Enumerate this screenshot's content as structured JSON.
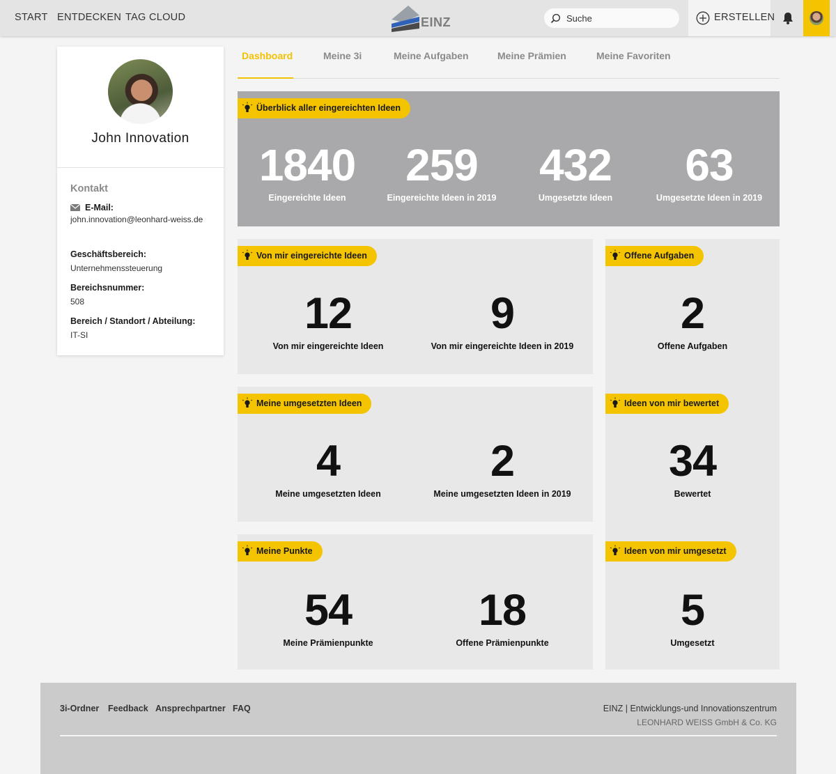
{
  "nav": {
    "start": "START",
    "entdecken": "ENTDECKEN",
    "tag_cloud": "TAG CLOUD",
    "logo_text": "EINZ",
    "search_placeholder": "Suche",
    "create_label": "ERSTELLEN"
  },
  "profile": {
    "name": "John Innovation",
    "contact_title": "Kontakt",
    "email_label": "E-Mail:",
    "email": "john.innovation@leonhard-weiss.de",
    "business_label": "Geschäftsbereich:",
    "business": "Unternehmenssteuerung",
    "area_number_label": "Bereichsnummer:",
    "area_number": "508",
    "department_label": "Bereich / Standort / Abteilung:",
    "department": "IT-SI"
  },
  "tabs": [
    "Dashboard",
    "Meine 3i",
    "Meine Aufgaben",
    "Meine Prämien",
    "Meine Favoriten"
  ],
  "overview": {
    "title": "Überblick aller eingereichten Ideen",
    "stats": [
      {
        "value": "1840",
        "label": "Eingereichte Ideen"
      },
      {
        "value": "259",
        "label": "Eingereichte Ideen in 2019"
      },
      {
        "value": "432",
        "label": "Umgesetzte Ideen"
      },
      {
        "value": "63",
        "label": "Umgesetzte Ideen in 2019"
      }
    ]
  },
  "my_ideas": {
    "title": "Von mir eingereichte Ideen",
    "stats": [
      {
        "value": "12",
        "label": "Von mir eingereichte Ideen"
      },
      {
        "value": "9",
        "label": "Von mir eingereichte Ideen in 2019"
      }
    ]
  },
  "open_tasks": {
    "title": "Offene Aufgaben",
    "stats": [
      {
        "value": "2",
        "label": "Offene Aufgaben"
      }
    ]
  },
  "implemented": {
    "title": "Meine umgesetzten Ideen",
    "stats": [
      {
        "value": "4",
        "label": "Meine umgesetzten Ideen"
      },
      {
        "value": "2",
        "label": "Meine umgesetzten Ideen in 2019"
      }
    ]
  },
  "rated": {
    "title": "Ideen von mir bewertet",
    "stats": [
      {
        "value": "34",
        "label": "Bewertet"
      }
    ]
  },
  "points": {
    "title": "Meine Punkte",
    "stats": [
      {
        "value": "54",
        "label": "Meine Prämienpunkte"
      },
      {
        "value": "18",
        "label": "Offene Prämienpunkte"
      }
    ]
  },
  "implemented_by_me": {
    "title": "Ideen von mir umgesetzt",
    "stats": [
      {
        "value": "5",
        "label": "Umgesetzt"
      }
    ]
  },
  "footer": {
    "links": [
      "3i-Ordner",
      "Feedback",
      "Ansprechpartner",
      "FAQ"
    ],
    "org_line": "EINZ | Entwicklungs-und Innovationszentrum",
    "company": "LEONHARD WEISS GmbH & Co. KG"
  },
  "colors": {
    "accent": "#f5c400",
    "overview_bg": "#a9a9ab",
    "panel_bg": "#e8e8e8"
  }
}
